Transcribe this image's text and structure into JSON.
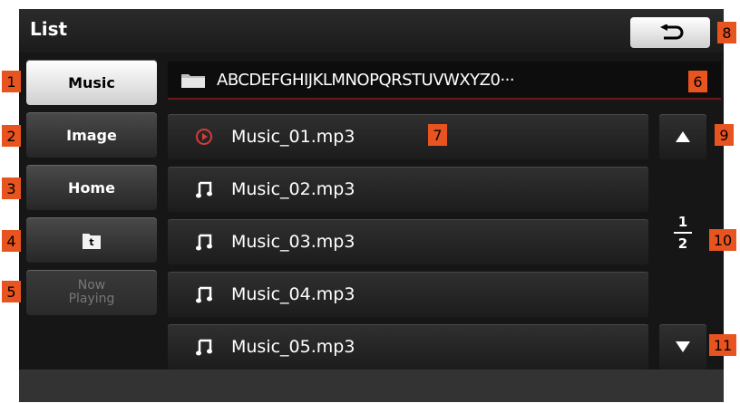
{
  "header": {
    "title": "List"
  },
  "sidebar": {
    "items": [
      {
        "label": "Music"
      },
      {
        "label": "Image"
      },
      {
        "label": "Home"
      },
      {
        "icon": "folder-up-icon"
      },
      {
        "label": "Now Playing"
      }
    ]
  },
  "path": {
    "folder_name": "ABCDEFGHIJKLMNOPQRSTUVWXYZ0···"
  },
  "files": [
    {
      "name": "Music_01.mp3",
      "icon": "now-playing-icon"
    },
    {
      "name": "Music_02.mp3",
      "icon": "music-note-icon"
    },
    {
      "name": "Music_03.mp3",
      "icon": "music-note-icon"
    },
    {
      "name": "Music_04.mp3",
      "icon": "music-note-icon"
    },
    {
      "name": "Music_05.mp3",
      "icon": "music-note-icon"
    }
  ],
  "pagination": {
    "current": "1",
    "total": "2"
  },
  "callouts": [
    "1",
    "2",
    "3",
    "4",
    "5",
    "6",
    "7",
    "8",
    "9",
    "10",
    "11"
  ],
  "colors": {
    "callout": "#e8541f",
    "playing_icon": "#d83a3a",
    "active_button": "#ffffff"
  }
}
